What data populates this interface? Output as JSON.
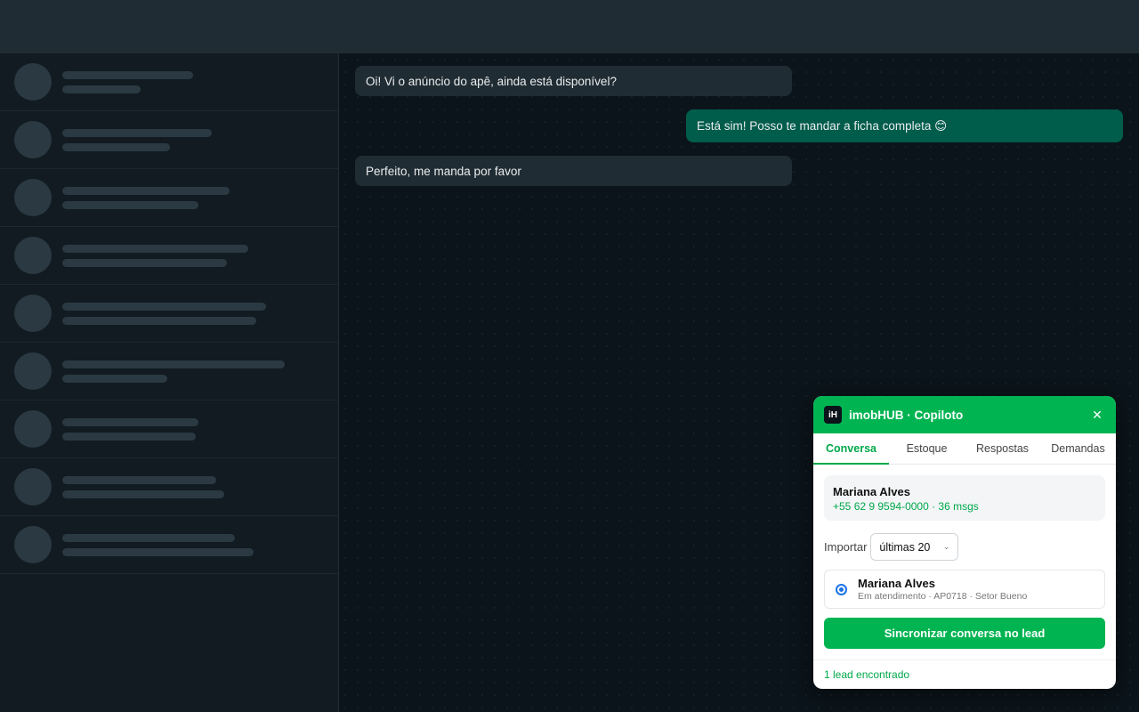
{
  "messages": [
    {
      "direction": "in",
      "text": "Oi! Vi o anúncio do apê, ainda está disponível?"
    },
    {
      "direction": "out",
      "text": "Está sim! Posso te mandar a ficha completa 😊"
    },
    {
      "direction": "in",
      "text": "Perfeito, me manda por favor"
    }
  ],
  "copilot": {
    "logo_text": "iH",
    "title": "imobHUB · Copiloto",
    "close_symbol": "✕",
    "tabs": [
      "Conversa",
      "Estoque",
      "Respostas",
      "Demandas"
    ],
    "active_tab": "Conversa",
    "contact": {
      "name": "Mariana Alves",
      "meta": "+55 62 9 9594-0000 · 36 msgs"
    },
    "import": {
      "label": "Importar",
      "selected": "últimas 20"
    },
    "lead": {
      "name": "Mariana Alves",
      "details": "Em atendimento · AP0718 · Setor Bueno",
      "selected": true
    },
    "sync_button": "Sincronizar conversa no lead",
    "footer": "1 lead encontrado"
  },
  "colors": {
    "brand_green": "#00b451",
    "incoming_bubble": "#202c33",
    "outgoing_bubble": "#005c4b"
  }
}
